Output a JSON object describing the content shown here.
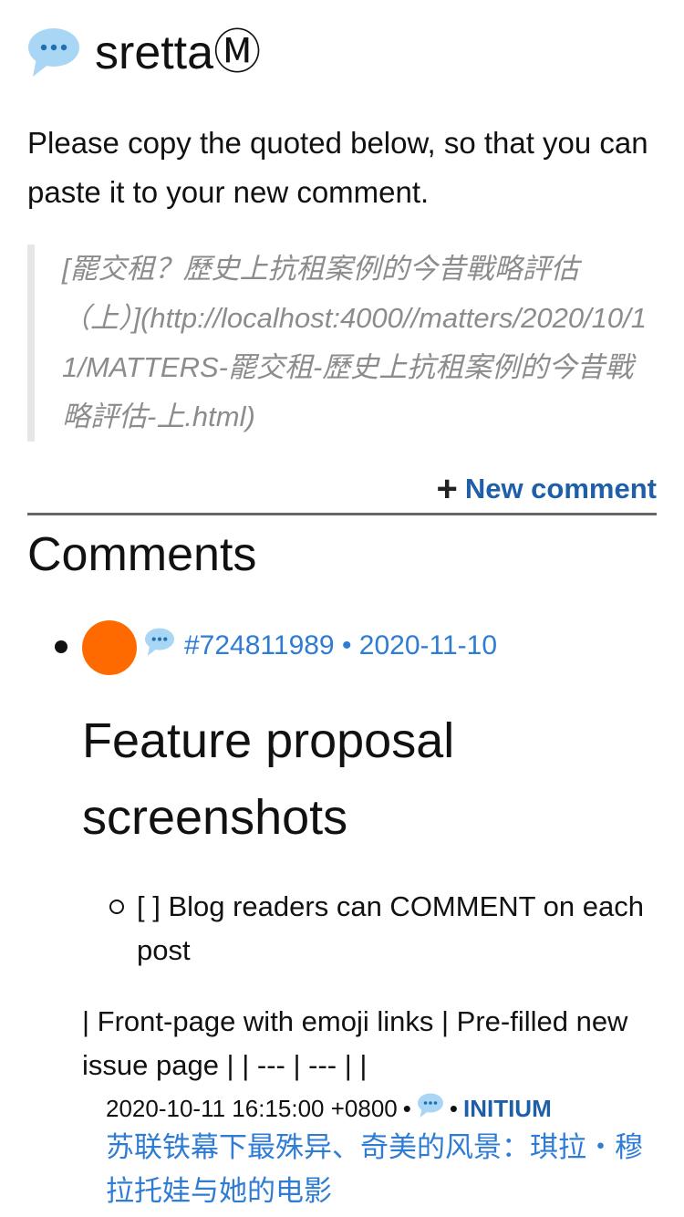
{
  "header": {
    "icon": "speech-bubble-icon",
    "title": "sretta",
    "title_mark": "Ⓜ"
  },
  "copy_hint": "Please copy the quoted below, so that you can paste it to your new comment.",
  "quote": {
    "text": "[罷交租？歷史上抗租案例的今昔戰略評估（上）](http://localhost:4000//matters/2020/10/11/MATTERS-罷交租-歷史上抗租案例的今昔戰略評估-上.html)"
  },
  "new_comment": {
    "plus": "+",
    "label": "New comment"
  },
  "comments": {
    "heading": "Comments",
    "items": [
      {
        "avatar_color": "#ff6a00",
        "meta": "#724811989 • 2020-11-10",
        "title": "Feature proposal screenshots",
        "task": "[ ] Blog readers can COMMENT on each post",
        "table_text": "| Front-page with emoji links | Pre-filled new issue page | | --- | --- | |",
        "feed": {
          "datetime": "2020-10-11 16:15:00 +0800",
          "sep1": "•",
          "sep2": "•",
          "source": "INITIUM",
          "title": "苏联铁幕下最殊异、奇美的风景：琪拉・穆拉托娃与她的电影"
        }
      }
    ]
  },
  "colors": {
    "link": "#2f7cd4",
    "source": "#1f5fa8",
    "quote_text": "#8c8c8c",
    "avatar": "#ff6a00"
  }
}
